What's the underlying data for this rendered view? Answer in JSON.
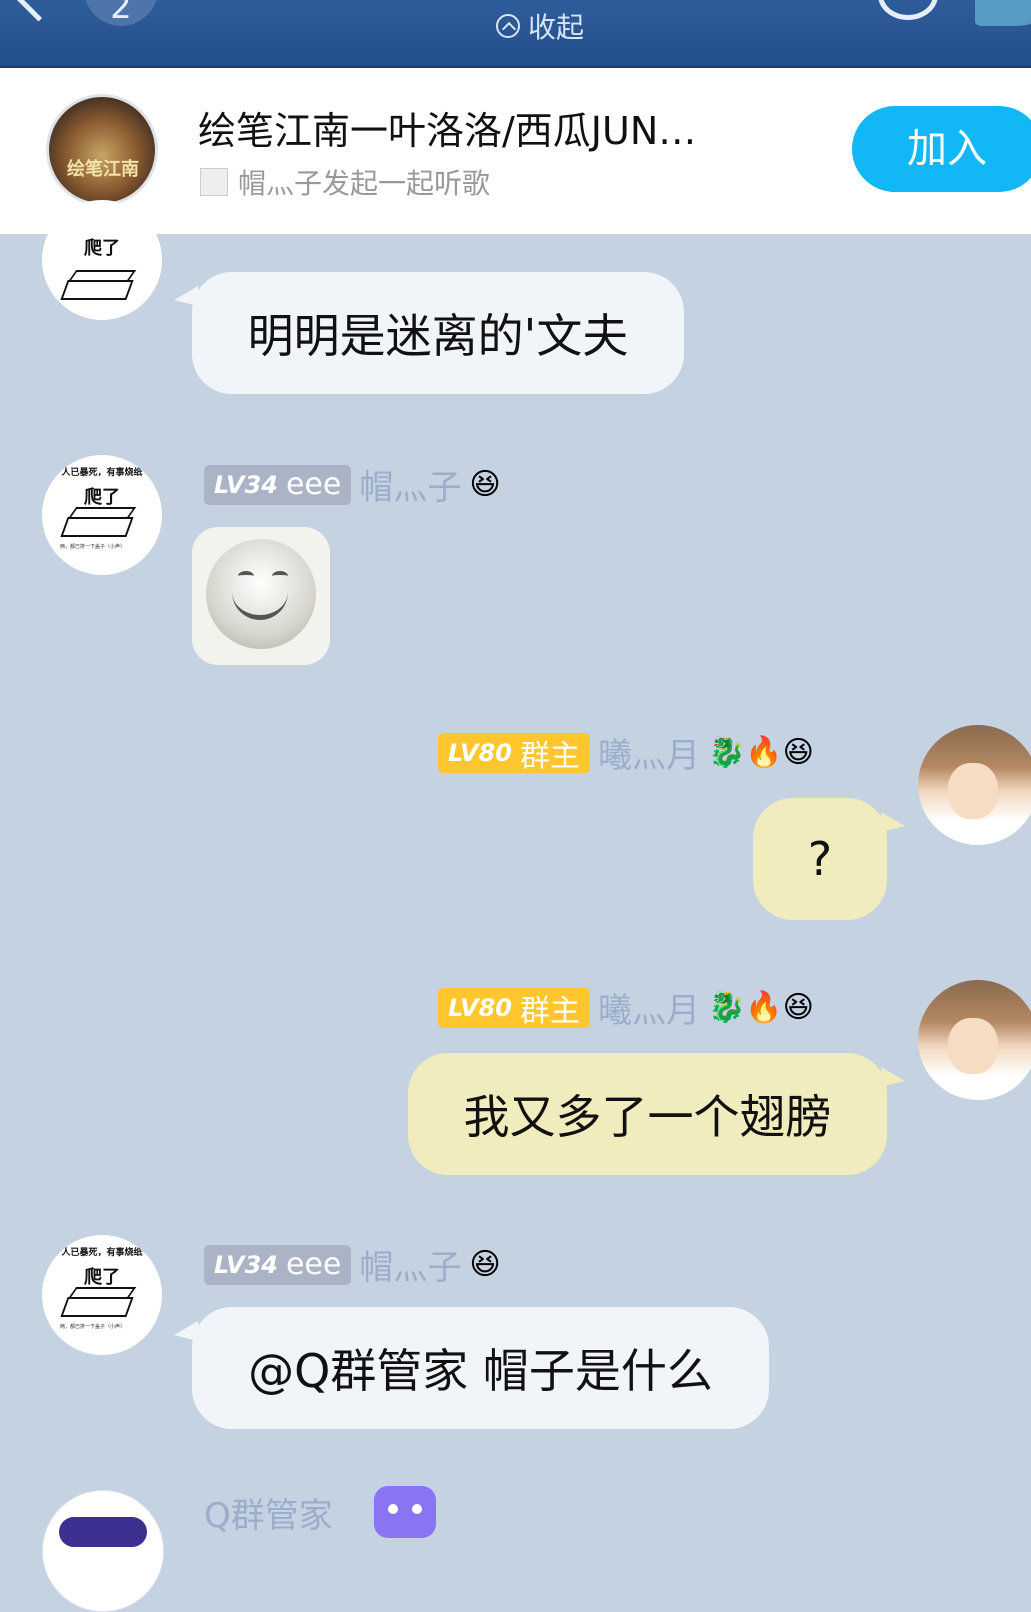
{
  "header": {
    "unread_count": "2",
    "collapse_label": "收起"
  },
  "banner": {
    "cover_text": "绘笔江南",
    "title": "绘笔江南一叶洛洛/西瓜JUN…",
    "subtitle": "帽灬子发起一起听歌",
    "join_label": "加入"
  },
  "messages": [
    {
      "side": "left",
      "sender": "帽灬子",
      "level": "LV34",
      "title": "eee",
      "text": "明明是迷离的'文夫"
    },
    {
      "side": "left",
      "sender": "帽灬子",
      "level": "LV34",
      "title": "eee",
      "emoji": "😆",
      "sticker": "smile-sticker"
    },
    {
      "side": "right",
      "sender": "曦灬月",
      "level": "LV80",
      "title": "群主",
      "emoji": "🐉🔥😆",
      "text": "?"
    },
    {
      "side": "right",
      "sender": "曦灬月",
      "level": "LV80",
      "title": "群主",
      "emoji": "🐉🔥😆",
      "text": "我又多了一个翅膀"
    },
    {
      "side": "left",
      "sender": "帽灬子",
      "level": "LV34",
      "title": "eee",
      "emoji": "😆",
      "text": "@Q群管家 帽子是什么"
    },
    {
      "side": "left",
      "sender": "Q群管家"
    }
  ],
  "avatar_text": {
    "line1": "人已暴死，有事烧纸",
    "line2": "爬了",
    "tiny": "两，都已挤一下盖子（小声）"
  }
}
